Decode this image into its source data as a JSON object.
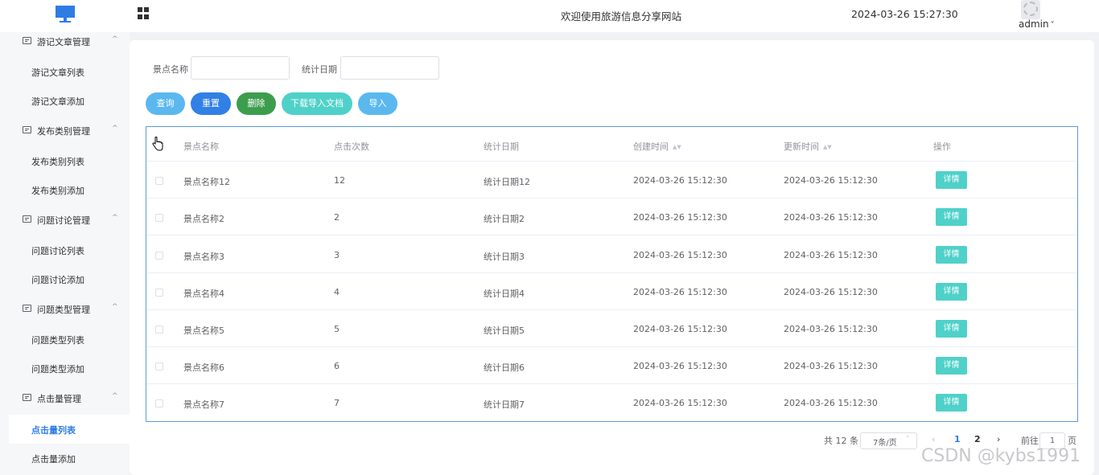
{
  "header": {
    "site_title": "欢迎使用旅游信息分享网站",
    "datetime": "2024-03-26 15:27:30",
    "user": "admin",
    "user_chevron": "˅"
  },
  "sidebar": {
    "groups": [
      {
        "label": "游记文章管理",
        "items": [
          "游记文章列表",
          "游记文章添加"
        ]
      },
      {
        "label": "发布类别管理",
        "items": [
          "发布类别列表",
          "发布类别添加"
        ]
      },
      {
        "label": "问题讨论管理",
        "items": [
          "问题讨论列表",
          "问题讨论添加"
        ]
      },
      {
        "label": "问题类型管理",
        "items": [
          "问题类型列表",
          "问题类型添加"
        ]
      },
      {
        "label": "点击量管理",
        "items": [
          "点击量列表",
          "点击量添加"
        ]
      }
    ],
    "active_item": "点击量列表",
    "chevron": "^"
  },
  "search": {
    "name_label": "景点名称",
    "name_value": "",
    "date_label": "统计日期",
    "date_value": ""
  },
  "buttons": {
    "query": "查询",
    "reset": "重置",
    "delete": "删除",
    "download": "下载导入文档",
    "import": "导入"
  },
  "colors": {
    "query": "#5bb8ef",
    "reset": "#3180e6",
    "delete": "#3c9d4e",
    "download": "#4fd1c9",
    "import": "#5bb8ef",
    "detail": "#4fd1c9"
  },
  "table": {
    "columns": [
      "景点名称",
      "点击次数",
      "统计日期",
      "创建时间",
      "更新时间",
      "操作"
    ],
    "rows": [
      {
        "name": "景点名称12",
        "clicks": "12",
        "date": "统计日期12",
        "created": "2024-03-26 15:12:30",
        "updated": "2024-03-26 15:12:30",
        "action": "详情"
      },
      {
        "name": "景点名称2",
        "clicks": "2",
        "date": "统计日期2",
        "created": "2024-03-26 15:12:30",
        "updated": "2024-03-26 15:12:30",
        "action": "详情"
      },
      {
        "name": "景点名称3",
        "clicks": "3",
        "date": "统计日期3",
        "created": "2024-03-26 15:12:30",
        "updated": "2024-03-26 15:12:30",
        "action": "详情"
      },
      {
        "name": "景点名称4",
        "clicks": "4",
        "date": "统计日期4",
        "created": "2024-03-26 15:12:30",
        "updated": "2024-03-26 15:12:30",
        "action": "详情"
      },
      {
        "name": "景点名称5",
        "clicks": "5",
        "date": "统计日期5",
        "created": "2024-03-26 15:12:30",
        "updated": "2024-03-26 15:12:30",
        "action": "详情"
      },
      {
        "name": "景点名称6",
        "clicks": "6",
        "date": "统计日期6",
        "created": "2024-03-26 15:12:30",
        "updated": "2024-03-26 15:12:30",
        "action": "详情"
      },
      {
        "name": "景点名称7",
        "clicks": "7",
        "date": "统计日期7",
        "created": "2024-03-26 15:12:30",
        "updated": "2024-03-26 15:12:30",
        "action": "详情"
      }
    ],
    "sort_glyph": "▲▼"
  },
  "pagination": {
    "total": "共 12 条",
    "page_size": "7条/页",
    "page_size_arrow": "˅",
    "prev": "‹",
    "pages": [
      "1",
      "2"
    ],
    "current_page": "1",
    "next": "›",
    "goto_label": "前往",
    "goto_value": "1",
    "goto_suffix": "页"
  },
  "watermark": "CSDN @kybs1991"
}
